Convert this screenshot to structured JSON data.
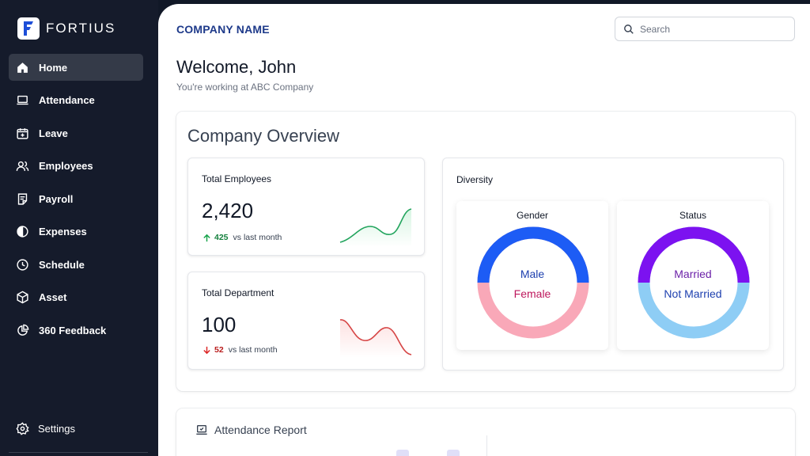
{
  "brand": {
    "name": "FORTIUS"
  },
  "sidebar": {
    "items": [
      {
        "label": "Home",
        "icon": "home-icon",
        "active": true
      },
      {
        "label": "Attendance",
        "icon": "laptop-icon"
      },
      {
        "label": "Leave",
        "icon": "calendar-plus-icon"
      },
      {
        "label": "Employees",
        "icon": "users-icon"
      },
      {
        "label": "Payroll",
        "icon": "document-icon"
      },
      {
        "label": "Expenses",
        "icon": "pie-half-icon"
      },
      {
        "label": "Schedule",
        "icon": "clock-icon"
      },
      {
        "label": "Asset",
        "icon": "box-icon"
      },
      {
        "label": "360 Feedback",
        "icon": "pie-chart-icon"
      }
    ],
    "settings": {
      "label": "Settings",
      "icon": "gear-icon"
    }
  },
  "header": {
    "company_name": "COMPANY NAME",
    "search_placeholder": "Search"
  },
  "welcome": {
    "title": "Welcome, John",
    "subtitle": "You're working at ABC Company"
  },
  "overview": {
    "title": "Company Overview",
    "total_employees": {
      "label": "Total Employees",
      "value": "2,420",
      "delta": "425",
      "delta_suffix": "vs last month",
      "trend": "up",
      "color": "#16a34a"
    },
    "total_department": {
      "label": "Total Department",
      "value": "100",
      "delta": "52",
      "delta_suffix": "vs last month",
      "trend": "down",
      "color": "#dc2626"
    },
    "diversity": {
      "label": "Diversity",
      "gender": {
        "title": "Gender",
        "segments": [
          {
            "label": "Male",
            "fraction": 0.5,
            "color": "#1d5cf5"
          },
          {
            "label": "Female",
            "fraction": 0.5,
            "color": "#f9a8b8"
          }
        ],
        "label_colors": [
          "#1e40af",
          "#be185d"
        ]
      },
      "status": {
        "title": "Status",
        "segments": [
          {
            "label": "Married",
            "fraction": 0.5,
            "color": "#7c12f0"
          },
          {
            "label": "Not Married",
            "fraction": 0.5,
            "color": "#8ecdf5"
          }
        ],
        "label_colors": [
          "#6b21a8",
          "#1e40af"
        ]
      }
    }
  },
  "attendance": {
    "title": "Attendance Report"
  },
  "colors": {
    "sidebar_bg": "#151b2b",
    "active_bg": "#343a48",
    "brand_blue": "#1e3a8a"
  }
}
